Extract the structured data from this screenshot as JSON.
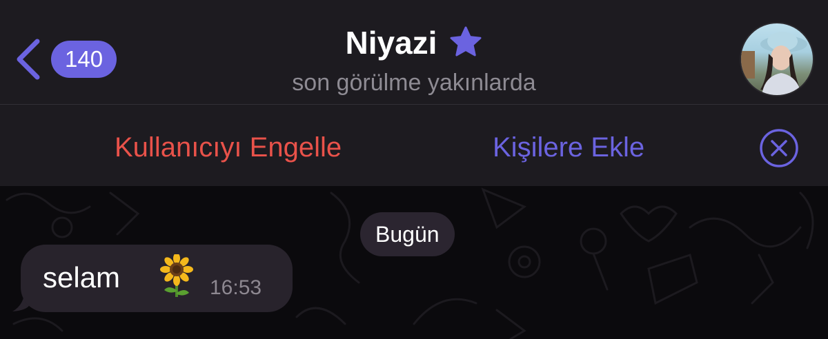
{
  "header": {
    "back_badge": "140",
    "title": "Niyazi",
    "status": "son görülme yakınlarda",
    "icons": {
      "back": "chevron-left-icon",
      "star": "star-icon",
      "avatar": "profile-photo"
    }
  },
  "action_bar": {
    "block_label": "Kullanıcıyı Engelle",
    "add_label": "Kişilere Ekle",
    "close_icon": "circle-x-icon"
  },
  "chat": {
    "date_label": "Bugün",
    "messages": [
      {
        "text": "selam",
        "emoji_icon": "sunflower-icon",
        "time": "16:53",
        "direction": "incoming"
      }
    ]
  },
  "colors": {
    "accent": "#6b63e0",
    "danger": "#e9524a",
    "header_bg": "#1d1b20",
    "chat_bg": "#0b0a0d",
    "bubble_bg": "#28232c"
  }
}
